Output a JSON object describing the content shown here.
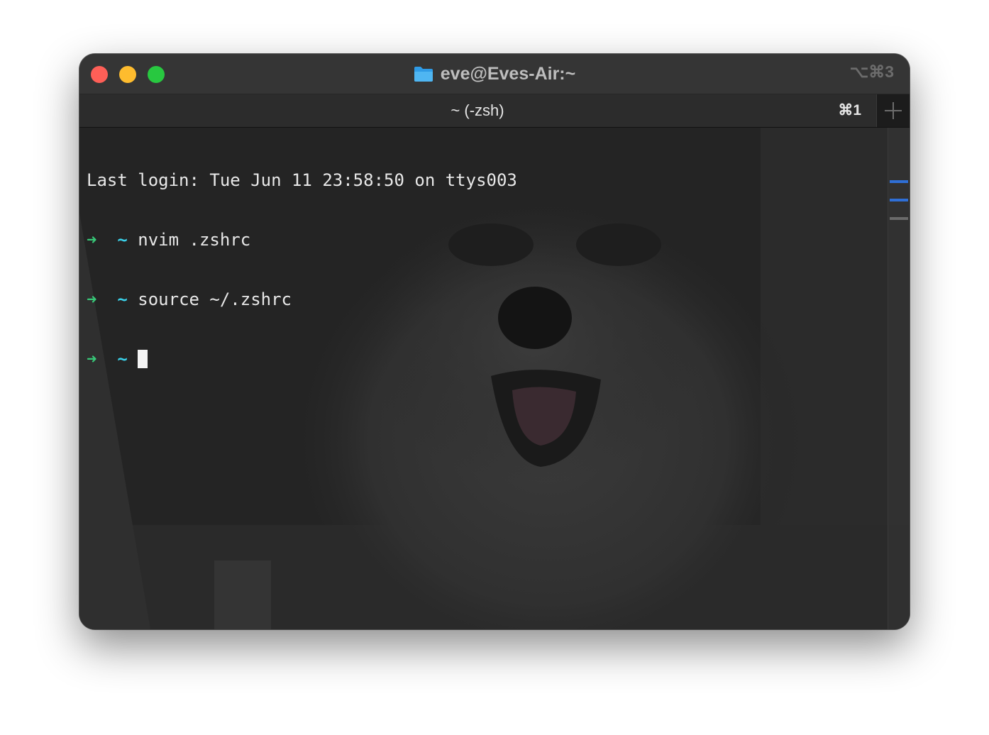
{
  "window": {
    "title": "eve@Eves-Air:~",
    "shortcut": "⌥⌘3"
  },
  "tab": {
    "title": "~ (-zsh)",
    "shortcut": "⌘1"
  },
  "terminal": {
    "last_login": "Last login: Tue Jun 11 23:58:50 on ttys003",
    "prompt_arrow": "➜",
    "prompt_dir": "~",
    "commands": [
      "nvim .zshrc",
      "source ~/.zshrc",
      ""
    ]
  },
  "colors": {
    "close": "#fe5f57",
    "minimize": "#febc2e",
    "maximize": "#28c840",
    "prompt_arrow": "#38c878",
    "prompt_dir": "#3ad0e8",
    "scroll_mark": "#2f6fd6"
  },
  "icons": {
    "title_folder": "folder-icon",
    "new_tab": "plus-icon"
  }
}
